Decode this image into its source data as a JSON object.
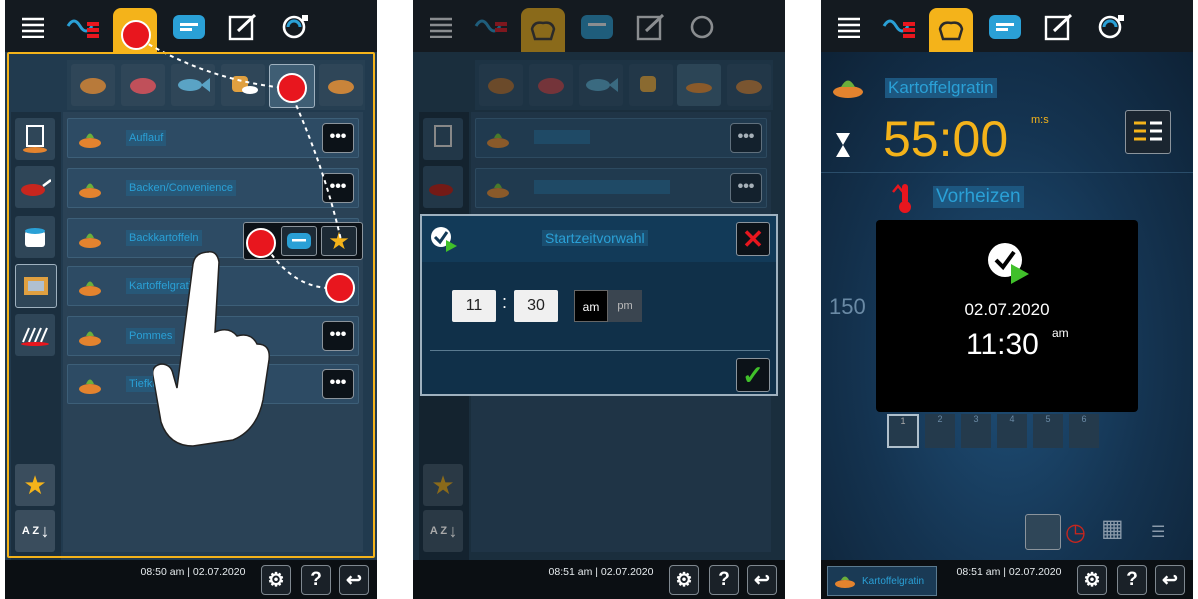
{
  "colors": {
    "accent": "#f4b31a",
    "marker": "#e8161e",
    "label_blue": "#2aa0d6",
    "confirm_green": "#40c02a"
  },
  "screen1": {
    "topbar_icons": [
      "menu-icon",
      "intelligent-cooking-icon",
      "cooking-paths-icon",
      "programs-icon",
      "edit-icon",
      "cleaning-icon"
    ],
    "food_categories": [
      "poultry-icon",
      "meat-icon",
      "fish-icon",
      "egg-dishes-icon",
      "side-dishes-icon",
      "bakery-icon"
    ],
    "methods": [
      "steamer-icon",
      "pan-icon",
      "pot-icon",
      "oven-icon",
      "grill-icon"
    ],
    "rows": [
      {
        "label": "Auflauf"
      },
      {
        "label": "Backen/Convenience"
      },
      {
        "label": "Backkartoffeln"
      },
      {
        "label": "Kartoffelgratin"
      },
      {
        "label": "Pommes"
      },
      {
        "label": "Tiefkühl"
      }
    ],
    "more_glyph": "•••",
    "sort_label": "A Z",
    "footer": {
      "time": "08:50 am | 02.07.2020",
      "help": "?"
    }
  },
  "screen2": {
    "dialog_title": "Startzeitvorwahl",
    "hour": "11",
    "separator": ":",
    "minute": "30",
    "am": "am",
    "pm": "pm",
    "rows": [
      {
        "label": ""
      },
      {
        "label": ""
      }
    ],
    "footer": {
      "time": "08:51 am | 02.07.2020",
      "help": "?"
    }
  },
  "screen3": {
    "recipe": "Kartoffelgratin",
    "timer": "55:00",
    "timer_unit": "m:s",
    "preheat": "Vorheizen",
    "temp_partial": "150",
    "date": "02.07.2020",
    "time": "11:30",
    "ampm": "am",
    "steps": [
      "1",
      "2",
      "3",
      "4",
      "5",
      "6"
    ],
    "footer_chip": "Kartoffelgratin",
    "footer": {
      "time": "08:51 am | 02.07.2020",
      "help": "?"
    }
  }
}
